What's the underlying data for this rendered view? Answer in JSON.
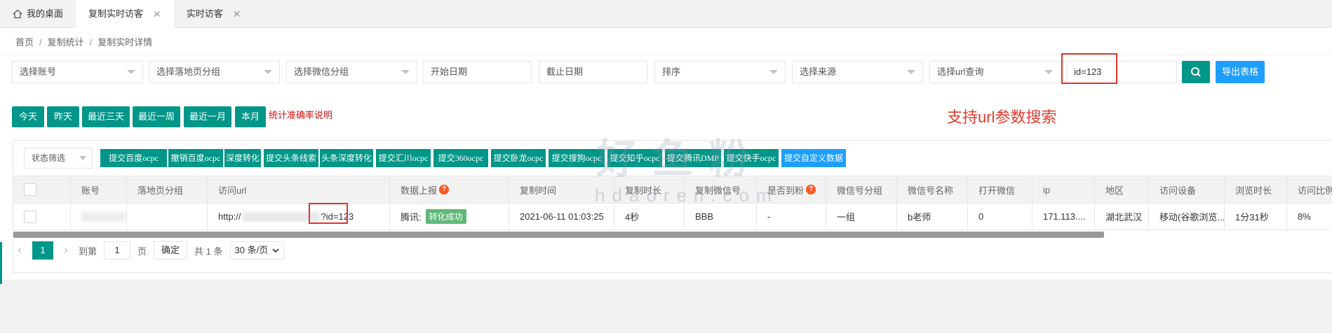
{
  "tabs": [
    {
      "label": "我的桌面",
      "active": false,
      "closable": false
    },
    {
      "label": "复制实时访客",
      "active": true,
      "closable": true
    },
    {
      "label": "实时访客",
      "active": false,
      "closable": true
    }
  ],
  "breadcrumb": [
    "首页",
    "复制统计",
    "复制实时详情"
  ],
  "filters": {
    "account": "选择账号",
    "landing_group": "选择落地页分组",
    "wechat_group": "选择微信分组",
    "start_date": "开始日期",
    "end_date": "截止日期",
    "sort": "排序",
    "source": "选择来源",
    "url_query": "选择url查询",
    "url_param": "id=123"
  },
  "export_label": "导出表格",
  "date_buttons": [
    "今天",
    "昨天",
    "最近三天",
    "最近一周",
    "最近一月",
    "本月"
  ],
  "stats_desc": "统计准确率说明",
  "note": "支持url参数搜索",
  "watermark": "好鱼粉",
  "watermark_sub": "hdaoren.com",
  "status_filter": "状态筛选",
  "toolbar_buttons": [
    "提交百度ocpc",
    "撤销百度ocpc",
    "深度转化",
    "提交头条线索",
    "头条深度转化",
    "提交汇川ocpc",
    "提交360ocpc",
    "提交卧龙ocpc",
    "提交搜狗ocpc",
    "提交知乎ocpc",
    "提交腾讯DMP",
    "提交快手ocpc",
    "提交自定义数据"
  ],
  "table": {
    "headers": [
      "账号",
      "落地页分组",
      "访问url",
      "数据上报",
      "复制时间",
      "复制时长",
      "复制微信号",
      "是否到粉",
      "微信号分组",
      "微信号名称",
      "打开微信",
      "ip",
      "地区",
      "访问设备",
      "浏览时长",
      "访问比例"
    ],
    "row": {
      "account": "",
      "landing_group": "",
      "url_prefix": "http://",
      "url_param": "?id=123",
      "report_platform": "腾讯:",
      "report_status": "转化成功",
      "copy_time": "2021-06-11 01:03:25",
      "copy_duration": "4秒",
      "wechat_id": "BBB",
      "is_fan": "-",
      "wechat_group": "一组",
      "wechat_name": "b老师",
      "open_wechat": "0",
      "ip": "171.113....",
      "region": "湖北武汉",
      "device": "移动(谷歌浏览...",
      "browse_duration": "1分31秒",
      "visit_ratio": "8%"
    }
  },
  "pagination": {
    "current_page": "1",
    "goto_label": "到第",
    "goto_value": "1",
    "page_unit": "页",
    "confirm_label": "确定",
    "total": "共 1 条",
    "page_size": "30 条/页"
  },
  "colors": {
    "primary": "#009688",
    "blue": "#1e9fff",
    "highlight": "#d9362b"
  }
}
